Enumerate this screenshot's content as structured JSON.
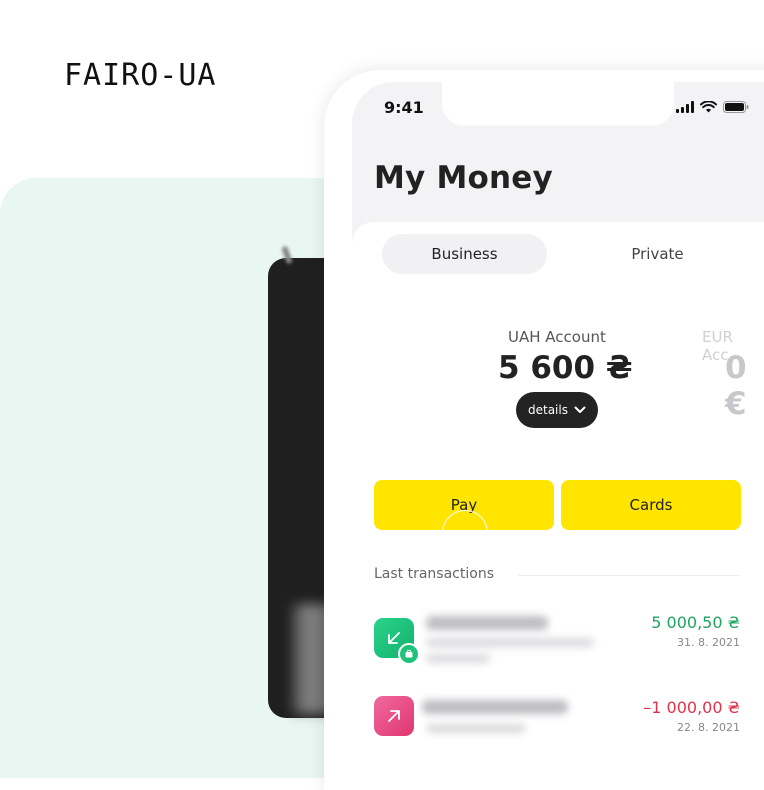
{
  "brand": {
    "logo": "FAIRO-UA"
  },
  "status_bar": {
    "time": "9:41"
  },
  "header": {
    "title": "My Money"
  },
  "tabs": [
    {
      "label": "Business",
      "active": true
    },
    {
      "label": "Private",
      "active": false
    }
  ],
  "accounts": [
    {
      "label": "UAH Account",
      "amount": "5 600 ₴"
    },
    {
      "label": "EUR Acc",
      "amount": "0 €"
    }
  ],
  "details_button": {
    "label": "details"
  },
  "actions": {
    "pay": "Pay",
    "cards": "Cards"
  },
  "transactions_section": {
    "title": "Last transactions",
    "items": [
      {
        "direction": "incoming",
        "amount": "5 000,50 ₴",
        "date": "31. 8. 2021",
        "color": "#1fa463"
      },
      {
        "direction": "outgoing",
        "amount": "–1 000,00 ₴",
        "date": "22. 8. 2021",
        "color": "#e0344b"
      }
    ]
  },
  "colors": {
    "accent_yellow": "#ffe500",
    "mint_background": "#e8f7f1",
    "income_green": "#1fa463",
    "expense_red": "#e0344b"
  }
}
